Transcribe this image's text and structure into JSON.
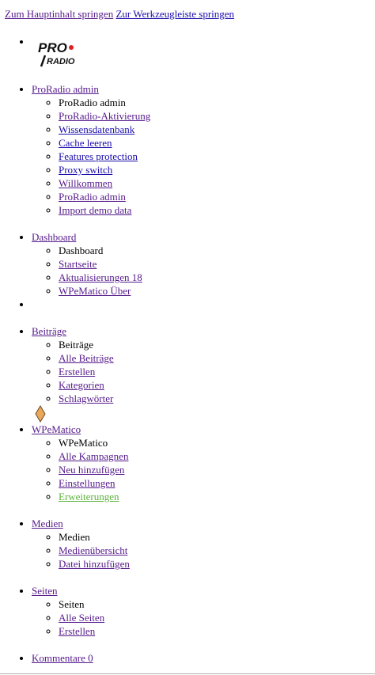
{
  "skip_links": {
    "main": "Zum Hauptinhalt springen",
    "toolbar": "Zur Werkzeugleiste springen"
  },
  "logo": {
    "text_top": "PRO",
    "text_bottom": "RADIO"
  },
  "menu": {
    "proradio": {
      "label": "ProRadio admin",
      "items": [
        "ProRadio admin",
        "ProRadio-Aktivierung",
        "Wissensdatenbank",
        "Cache leeren",
        "Features protection",
        "Proxy switch",
        "Willkommen",
        "ProRadio admin",
        "Import demo data"
      ]
    },
    "dashboard": {
      "label": "Dashboard",
      "items": [
        "Dashboard",
        "Startseite",
        "Aktualisierungen 18",
        "WPeMatico Über"
      ]
    },
    "beitraege": {
      "label": "Beiträge",
      "items": [
        "Beiträge",
        "Alle Beiträge",
        "Erstellen",
        "Kategorien",
        "Schlagwörter"
      ]
    },
    "wpematico": {
      "label": "WPeMatico",
      "icon": "diamond-icon",
      "items": [
        "WPeMatico",
        "Alle Kampagnen",
        "Neu hinzufügen",
        "Einstellungen",
        "Erweiterungen"
      ]
    },
    "medien": {
      "label": "Medien",
      "items": [
        "Medien",
        "Medienübersicht",
        "Datei hinzufügen"
      ]
    },
    "seiten": {
      "label": "Seiten",
      "items": [
        "Seiten",
        "Alle Seiten",
        "Erstellen"
      ]
    },
    "kommentare": {
      "label": "Kommentare 0"
    }
  },
  "colors": {
    "visited_link": "#551a8b",
    "link": "#1a0dab",
    "highlight_link": "#5bb33a",
    "icon_orange": "#e8a75b"
  }
}
